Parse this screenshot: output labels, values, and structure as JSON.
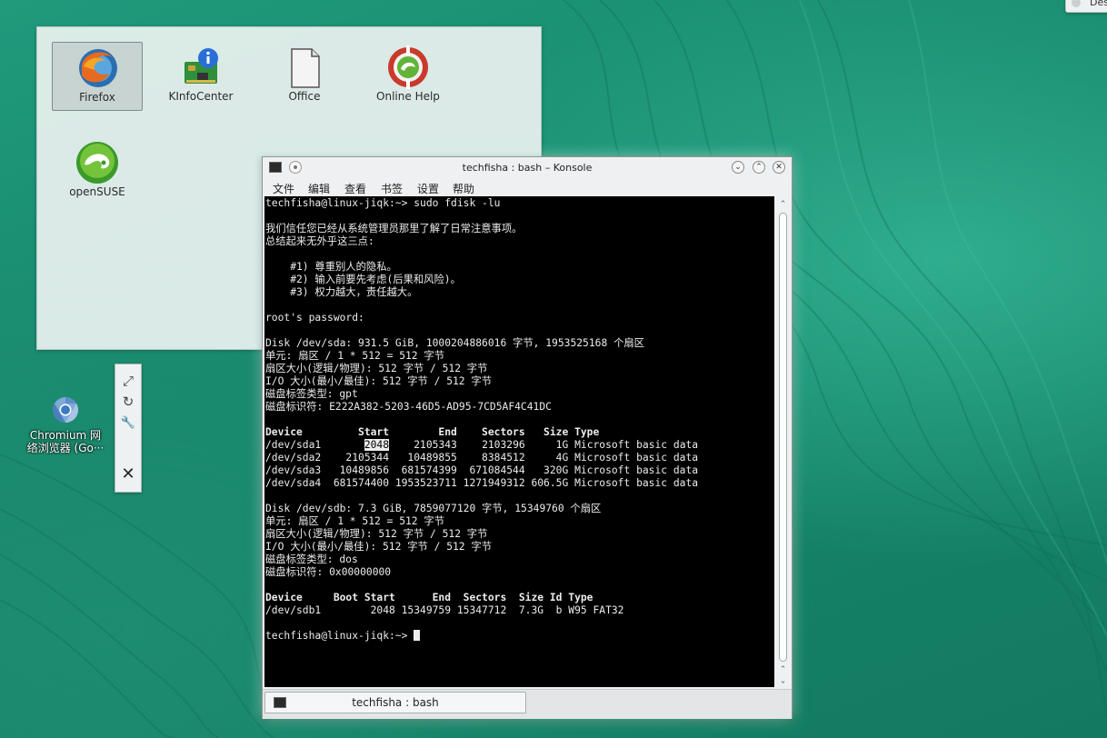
{
  "corner_widget": {
    "label": "Des"
  },
  "folder_view": {
    "items": [
      {
        "label": "Firefox",
        "icon": "firefox-icon",
        "selected": true
      },
      {
        "label": "KInfoCenter",
        "icon": "kinfocenter-icon"
      },
      {
        "label": "Office",
        "icon": "office-document-icon"
      },
      {
        "label": "Online Help",
        "icon": "online-help-icon"
      },
      {
        "label": "openSUSE",
        "icon": "opensuse-icon"
      }
    ]
  },
  "toolbox": {
    "buttons": [
      {
        "name": "resize",
        "icon": "resize-icon",
        "glyph": "⤢"
      },
      {
        "name": "rotate",
        "icon": "rotate-icon",
        "glyph": "↻"
      },
      {
        "name": "settings",
        "icon": "wrench-icon",
        "glyph": "🔧"
      },
      {
        "name": "remove",
        "icon": "close-icon",
        "glyph": "✕"
      }
    ]
  },
  "desktop_icons": [
    {
      "label_line1": "Chromium 网",
      "label_line2": "络浏览器 (Go···",
      "icon": "chromium-icon"
    }
  ],
  "konsole": {
    "title": "techfisha : bash – Konsole",
    "menu": [
      "文件",
      "编辑",
      "查看",
      "书签",
      "设置",
      "帮助"
    ],
    "tab_label": "techfisha : bash",
    "terminal": {
      "prompt": "techfisha@linux-jiqk:~> ",
      "command": "sudo fdisk -lu",
      "lecture": [
        "我们信任您已经从系统管理员那里了解了日常注意事项。",
        "总结起来无外乎这三点:",
        "",
        "    #1) 尊重别人的隐私。",
        "    #2) 输入前要先考虑(后果和风险)。",
        "    #3) 权力越大，责任越大。",
        "",
        "root's password:",
        ""
      ],
      "disk1_info": [
        "Disk /dev/sda: 931.5 GiB, 1000204886016 字节, 1953525168 个扇区",
        "单元: 扇区 / 1 * 512 = 512 字节",
        "扇区大小(逻辑/物理): 512 字节 / 512 字节",
        "I/O 大小(最小/最佳): 512 字节 / 512 字节",
        "磁盘标签类型: gpt",
        "磁盘标识符: E222A382-5203-46D5-AD95-7CD5AF4C41DC",
        ""
      ],
      "disk1_header": "Device         Start        End    Sectors   Size Type",
      "disk1_row1_a": "/dev/sda1       ",
      "disk1_row1_hl": "2048",
      "disk1_row1_b": "    2105343    2103296     1G Microsoft basic data",
      "disk1_rows": [
        "/dev/sda2    2105344   10489855    8384512     4G Microsoft basic data",
        "/dev/sda3   10489856  681574399  671084544   320G Microsoft basic data",
        "/dev/sda4  681574400 1953523711 1271949312 606.5G Microsoft basic data",
        ""
      ],
      "disk2_info": [
        "Disk /dev/sdb: 7.3 GiB, 7859077120 字节, 15349760 个扇区",
        "单元: 扇区 / 1 * 512 = 512 字节",
        "扇区大小(逻辑/物理): 512 字节 / 512 字节",
        "I/O 大小(最小/最佳): 512 字节 / 512 字节",
        "磁盘标签类型: dos",
        "磁盘标识符: 0x00000000",
        ""
      ],
      "disk2_header": "Device     Boot Start      End  Sectors  Size Id Type",
      "disk2_rows": [
        "/dev/sdb1        2048 15349759 15347712  7.3G  b W95 FAT32",
        ""
      ],
      "final_prompt": "techfisha@linux-jiqk:~> "
    }
  },
  "colors": {
    "desktop": "#17876a",
    "terminal_bg": "#000000",
    "terminal_fg": "#ececec"
  }
}
